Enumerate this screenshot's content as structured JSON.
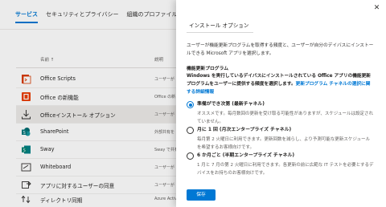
{
  "tabs": [
    {
      "label": "サービス",
      "active": true
    },
    {
      "label": "セキュリティとプライバシー",
      "active": false
    },
    {
      "label": "組織のプロファイル",
      "active": false
    }
  ],
  "table": {
    "col_name": "名前 ↑",
    "col_desc": "説明",
    "rows": [
      {
        "name": "Office Scripts",
        "desc": "ユーザーが",
        "icon": "office-scripts-icon",
        "selected": false
      },
      {
        "name": "Office の新機能",
        "desc": "Office の新",
        "icon": "office-whats-new-icon",
        "selected": false
      },
      {
        "name": "Officeインストール オプション",
        "desc": "ユーザーが",
        "icon": "office-install-icon",
        "selected": true
      },
      {
        "name": "SharePoint",
        "desc": "外部共有を",
        "icon": "sharepoint-icon",
        "selected": false
      },
      {
        "name": "Sway",
        "desc": "Sway で共有",
        "icon": "sway-icon",
        "selected": false
      },
      {
        "name": "Whiteboard",
        "desc": "ユーザーが",
        "icon": "whiteboard-icon",
        "selected": false
      },
      {
        "name": "アプリに対するユーザーの同意",
        "desc": "ユーザーが",
        "icon": "user-consent-icon",
        "selected": false
      },
      {
        "name": "ディレクトリ同期",
        "desc": "Azure Activ",
        "icon": "directory-sync-icon",
        "selected": false
      }
    ]
  },
  "panel": {
    "title": "インストール オプション",
    "intro": "ユーザーが機能更新プログラムを取得する頻度と、ユーザーが自分のデイバスにインストールできる Microsoft アプリを選択します。",
    "section_title": "機能更新プログラム",
    "section_text": "Windows を実行しているデイバスにインストールされている Office アプリの機能更新プログラムをユーザーに提供する頻度を選択します。",
    "section_link": "更新プログラム チャネルの選択に関する詳細情報",
    "options": [
      {
        "label": "準備ができ次第 (最新チャネル)",
        "desc": "オススメです。毎月数回の更新を受け取る可能性がありますが、スケジュールは設定されていません。",
        "checked": true
      },
      {
        "label": "月に 1 回 (月次エンタープライズ チャネル)",
        "desc": "毎月第 2 火曜日に利用できます。更新回数を減らし、より予測可能な更新スケジュールを希望するお客様向けです。",
        "checked": false
      },
      {
        "label": "6 か月ごと (半期エンタープライズ チャネル)",
        "desc": "1 月と 7 月の第 2 火曜日に利用できます。各更新の前に広範な IT テストを必要とするデバイスをお持ちのお客様向けです。",
        "checked": false
      }
    ],
    "save_label": "保存",
    "close_glyph": "✕"
  },
  "colors": {
    "accent": "#0078d4",
    "text": "#201f1e"
  }
}
